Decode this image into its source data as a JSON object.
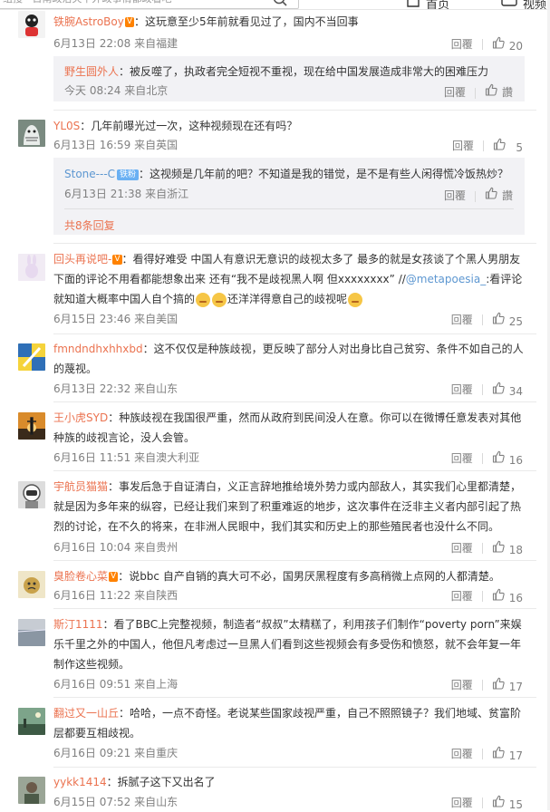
{
  "header": {
    "search_placeholder": "组搜 · 日南政治欠下外政事情都政看吧",
    "home_label": "首页",
    "video_label": "视频"
  },
  "common": {
    "reply_label": "回覆"
  },
  "comments": [
    {
      "user": "铁腕AstroBoy",
      "vip": "V",
      "text": "：这玩意至少5年前就看见过了，国内不当回事",
      "time": "6月13日 22:08 来自福建",
      "likes": "20",
      "replies": [
        {
          "user": "野生圆外人",
          "text": "：被反噬了，执政者完全短视不重视，现在给中国发展造成非常大的困难压力",
          "time": "今天 08:24 来自北京",
          "likes": "讚"
        }
      ]
    },
    {
      "user": "YL0S",
      "text": "：几年前曝光过一次，这种视频现在还有吗？",
      "time": "6月13日 16:59 来自英国",
      "likes": "5",
      "replies": [
        {
          "user": "Stone---C",
          "badge": "铁粉",
          "text": "：这视频是几年前的吧？不知道是我的错觉，是不是有些人闲得慌冷饭热炒？",
          "time": "6月13日 21:38 来自浙江",
          "likes": "讚"
        }
      ],
      "total_replies": "共8条回复"
    },
    {
      "user": "回头再说吧-",
      "vip": "V",
      "text_part1": "：看得好难受 中国人有意识无意识的歧视太多了 最多的就是女孩谈了个黑人男朋友 下面的评论不用看都能想象出来 还有“我不是歧视黑人啊 但xxxxxxxx” //",
      "mention": "@metapoesia_",
      "text_part2": ":看评论就知道大概率中国人自个搞的",
      "text_part3": "还洋洋得意自己的歧视呢",
      "time": "6月15日 23:46 来自美国",
      "likes": "25"
    },
    {
      "user": "fmndndhxhhxbd",
      "text": "：这不仅仅是种族歧视，更反映了部分人对出身比自己贫穷、条件不如自己的人的蔑视。",
      "time": "6月13日 22:32 来自山东",
      "likes": "34"
    },
    {
      "user": "王小虎SYD",
      "text": "：种族歧视在我国很严重，然而从政府到民间没人在意。你可以在微博任意发表对其他种族的歧视言论，没人会管。",
      "time": "6月16日 11:51 来自澳大利亚",
      "likes": "16"
    },
    {
      "user": "宇航员猫猫",
      "text": "：事发后急于自证清白，义正言辞地推给境外势力或内部敌人，其实我们心里都清楚，就是因为多年来的纵容，已经让我们来到了积重难返的地步，这次事件在泛非主义者内部引起了热烈的讨论，在不久的将来，在非洲人民眼中，我们其实和历史上的那些殖民者也没什么不同。",
      "time": "6月16日 10:04 来自贵州",
      "likes": "18"
    },
    {
      "user": "臭脸卷心菜",
      "vip": "V",
      "text": "：说bbc 自产自销的真大可不必，国男厌黑程度有多高稍微上点网的人都清楚。",
      "time": "6月16日 11:22 来自陕西",
      "likes": "16"
    },
    {
      "user": "斯汀1111",
      "text": "：看了BBC上完整视频，制造者“叔叔”太精糕了，利用孩子们制作“poverty porn”来娱乐千里之外的中国人，他但凡考虑过一旦黑人们看到这些视频会有多受伤和愤怒，就不会年复一年制作这些视频。",
      "time": "6月16日 09:51 来自上海",
      "likes": "17"
    },
    {
      "user": "翻过又一山丘",
      "text": "：哈哈，一点不奇怪。老说某些国家歧视严重，自己不照照镜子？我们地域、贫富阶层都要互相歧视。",
      "time": "6月16日 09:21 来自重庆",
      "likes": "17"
    },
    {
      "user": "yykk1414",
      "text": "：拆腻子这下又出名了",
      "time": "6月15日 07:52 来自山东",
      "likes": "15"
    }
  ]
}
